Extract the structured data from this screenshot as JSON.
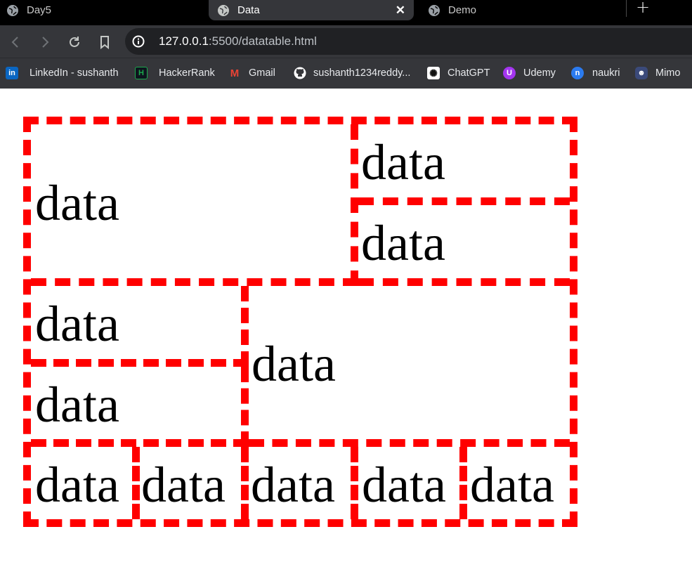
{
  "browser": {
    "tabs": [
      {
        "label": "Day5",
        "active": false
      },
      {
        "label": "Data",
        "active": true
      },
      {
        "label": "Demo",
        "active": false
      }
    ],
    "new_tab_symbol": "+",
    "close_symbol": "✕",
    "address": {
      "host": "127.0.0.1",
      "rest": ":5500/datatable.html"
    },
    "bookmarks": [
      {
        "label": "LinkedIn - sushanth",
        "icon": "linkedin-icon",
        "color": "#0a66c2",
        "glyph": "in"
      },
      {
        "label": "HackerRank",
        "icon": "hackerrank-icon",
        "color": "#1ba94c",
        "glyph": "H"
      },
      {
        "label": "Gmail",
        "icon": "gmail-icon",
        "color": "#ea4335",
        "glyph": "M"
      },
      {
        "label": "sushanth1234reddy...",
        "icon": "github-icon",
        "color": "#ffffff",
        "glyph": "⬤"
      },
      {
        "label": "ChatGPT",
        "icon": "chatgpt-icon",
        "color": "#ffffff",
        "glyph": "✺"
      },
      {
        "label": "Udemy",
        "icon": "udemy-icon",
        "color": "#a435f0",
        "glyph": "U"
      },
      {
        "label": "naukri",
        "icon": "naukri-icon",
        "color": "#2b7bf0",
        "glyph": "n"
      },
      {
        "label": "Mimo",
        "icon": "mimo-icon",
        "color": "#3b4a7a",
        "glyph": "☻"
      }
    ],
    "colors": {
      "chrome_dark": "#000000",
      "toolbar": "#35363a",
      "omnibox": "#202124"
    }
  },
  "table": {
    "border_color": "#ff0000",
    "cells": [
      "data",
      "data",
      "data",
      "data",
      "data",
      "data",
      "data",
      "data",
      "data",
      "data",
      "data"
    ]
  }
}
